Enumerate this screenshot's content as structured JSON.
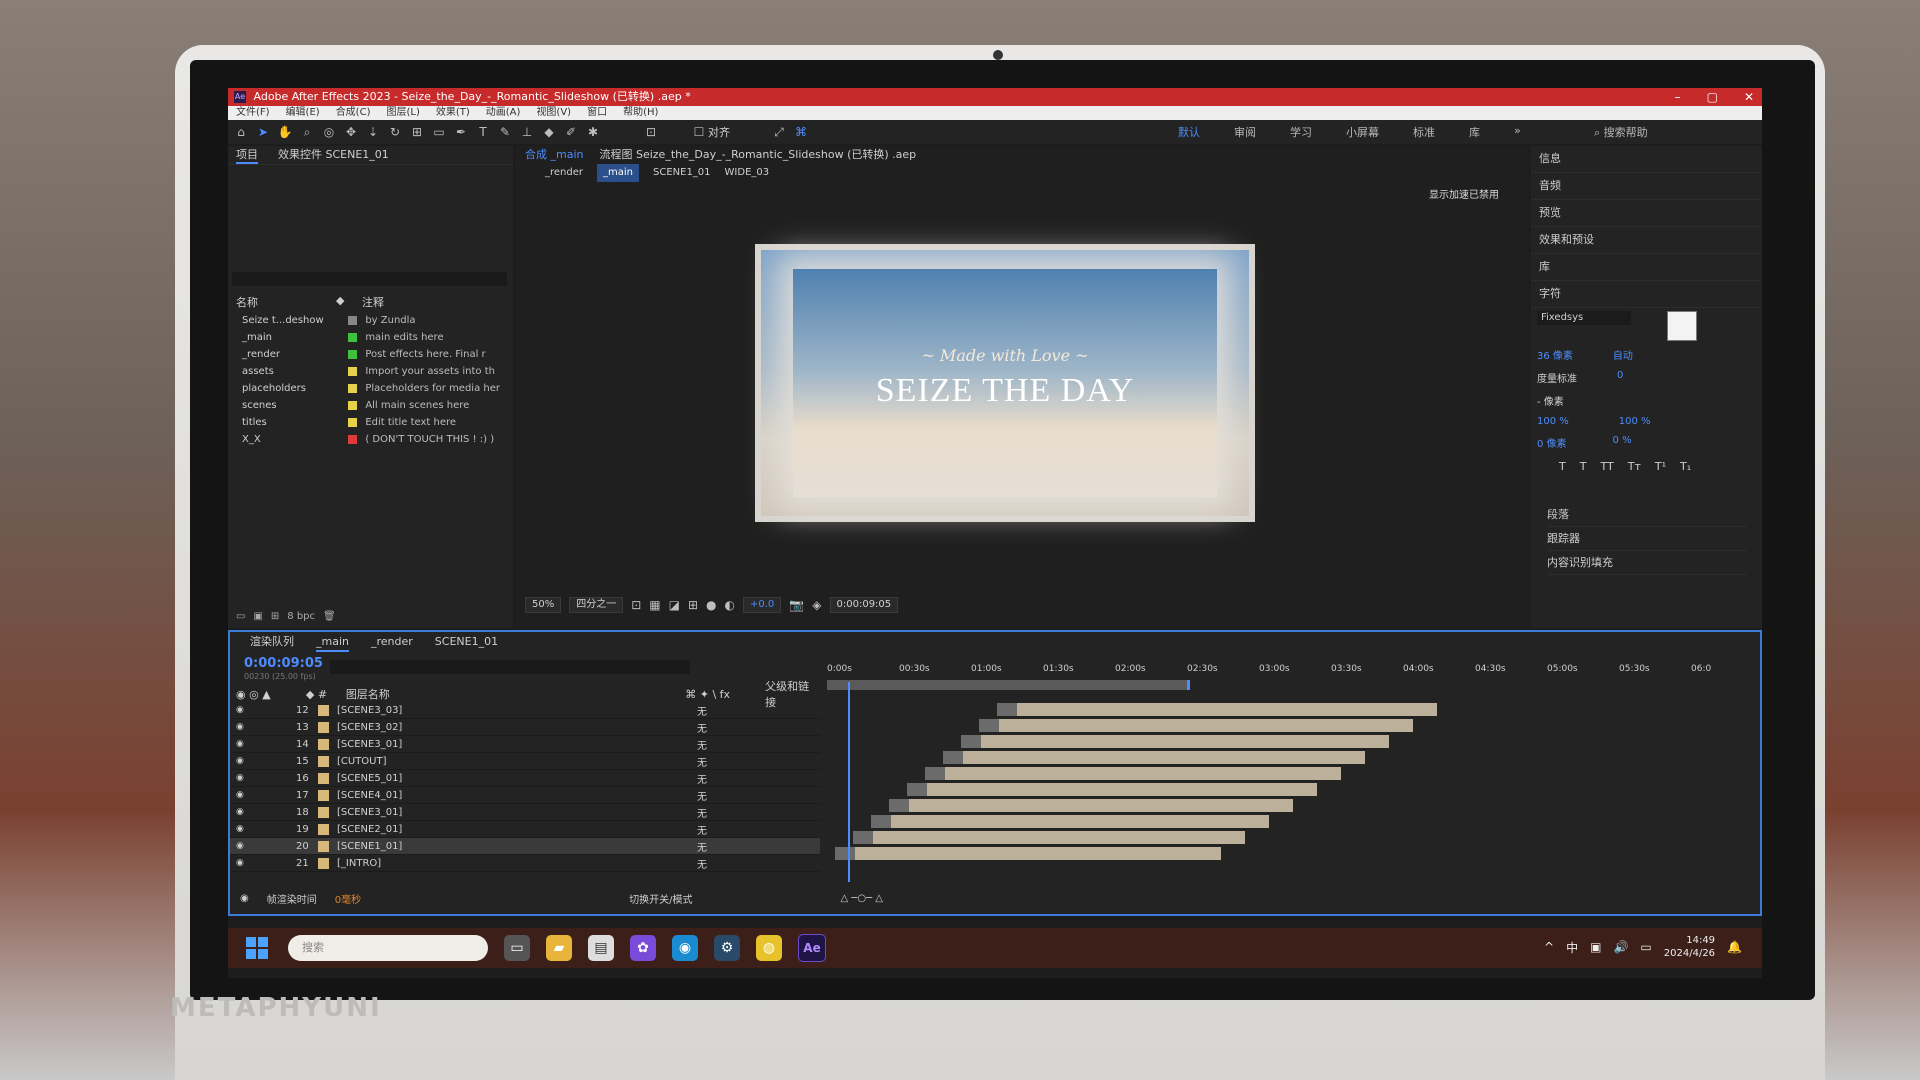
{
  "window": {
    "title": "Adobe After Effects 2023 - Seize_the_Day_-_Romantic_Slideshow (已转换) .aep *",
    "controls": [
      "–",
      "▢",
      "✕"
    ]
  },
  "menubar": [
    "文件(F)",
    "编辑(E)",
    "合成(C)",
    "图层(L)",
    "效果(T)",
    "动画(A)",
    "视图(V)",
    "窗口",
    "帮助(H)"
  ],
  "toolbar": {
    "align_label": "对齐",
    "workspaces": [
      "默认",
      "审阅",
      "学习",
      "小屏幕",
      "标准",
      "库"
    ],
    "active_workspace": "默认",
    "search_help": "搜索帮助"
  },
  "project": {
    "tab_project": "项目",
    "tab_effects": "效果控件 SCENE1_01",
    "col_name": "名称",
    "col_comment": "注释",
    "items": [
      {
        "name": "Seize t...deshow",
        "comment": "by Zundla",
        "color": "#888888"
      },
      {
        "name": "_main",
        "comment": "main edits here",
        "color": "#3ec23e"
      },
      {
        "name": "_render",
        "comment": "Post effects here. Final r",
        "color": "#3ec23e"
      },
      {
        "name": "assets",
        "comment": "Import your assets into th",
        "color": "#e6d24a"
      },
      {
        "name": "placeholders",
        "comment": "Placeholders for media her",
        "color": "#e6d24a"
      },
      {
        "name": "scenes",
        "comment": "All main scenes here",
        "color": "#e6d24a"
      },
      {
        "name": "titles",
        "comment": "Edit title text here",
        "color": "#e6d24a"
      },
      {
        "name": "X_X",
        "comment": "( DON'T TOUCH THIS ! :) )",
        "color": "#e03a3a"
      }
    ],
    "bpc": "8 bpc"
  },
  "viewer": {
    "tab_comp": "合成 _main",
    "tab_flow": "流程图 Seize_the_Day_-_Romantic_Slideshow (已转换) .aep",
    "crumbs": [
      "_render",
      "_main",
      "SCENE1_01",
      "WIDE_03"
    ],
    "active_crumb": "_main",
    "accel_notice": "显示加速已禁用",
    "frame_made": "~ Made with Love ~",
    "frame_title": "SEIZE THE DAY",
    "zoom": "50%",
    "resolution": "四分之一",
    "exposure": "+0.0",
    "timecode": "0:00:09:05"
  },
  "rpanel": {
    "items": [
      "信息",
      "音频",
      "预览",
      "效果和预设",
      "库"
    ],
    "char_title": "字符",
    "font": "Fixedsys",
    "size": "36 像素",
    "leading": "自动",
    "kerning": "度量标准",
    "tracking": "0",
    "stroke": "- 像素",
    "vscale": "100 %",
    "hscale": "100 %",
    "baseline": "0 像素",
    "tsume": "0 %",
    "type_styles": [
      "T",
      "T",
      "TT",
      "Tт",
      "T¹",
      "T₁"
    ],
    "lower": [
      "段落",
      "跟踪器",
      "内容识别填充"
    ]
  },
  "timeline": {
    "tabs": [
      "渲染队列",
      "_main",
      "_render",
      "SCENE1_01"
    ],
    "timecode": "0:00:09:05",
    "timecode_sub": "00230 (25.00 fps)",
    "col_layer": "图层名称",
    "col_parent": "父级和链接",
    "ruler": [
      "0:00s",
      "00:30s",
      "01:00s",
      "01:30s",
      "02:00s",
      "02:30s",
      "03:00s",
      "03:30s",
      "04:00s",
      "04:30s",
      "05:00s",
      "05:30s",
      "06:0"
    ],
    "layers": [
      {
        "num": "12",
        "name": "[SCENE3_03]",
        "parent": "无"
      },
      {
        "num": "13",
        "name": "[SCENE3_02]",
        "parent": "无"
      },
      {
        "num": "14",
        "name": "[SCENE3_01]",
        "parent": "无"
      },
      {
        "num": "15",
        "name": "[CUTOUT]",
        "parent": "无"
      },
      {
        "num": "16",
        "name": "[SCENE5_01]",
        "parent": "无"
      },
      {
        "num": "17",
        "name": "[SCENE4_01]",
        "parent": "无"
      },
      {
        "num": "18",
        "name": "[SCENE3_01]",
        "parent": "无"
      },
      {
        "num": "19",
        "name": "[SCENE2_01]",
        "parent": "无"
      },
      {
        "num": "20",
        "name": "[SCENE1_01]",
        "parent": "无"
      },
      {
        "num": "21",
        "name": "[_INTRO]",
        "parent": "无"
      }
    ],
    "selected_layer": "20",
    "footer_render_label": "帧渲染时间",
    "footer_render_value": "0毫秒",
    "footer_toggle": "切换开关/模式"
  },
  "taskbar": {
    "search_placeholder": "搜索",
    "ime": "中",
    "time": "14:49",
    "date": "2024/4/26"
  },
  "device": {
    "brand": "METAPHYUNI"
  }
}
